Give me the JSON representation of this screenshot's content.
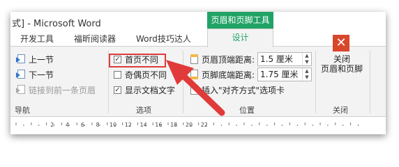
{
  "window": {
    "title": "式] - Microsoft Word"
  },
  "context_tab_header": "页眉和页脚工具",
  "tabs": [
    {
      "label": "开发工具"
    },
    {
      "label": "福昕阅读器"
    },
    {
      "label": "Word技巧达人"
    },
    {
      "label": "设计"
    }
  ],
  "navigation": {
    "prev": "上一节",
    "next": "下一节",
    "link_prev": "链接到前一条页眉",
    "group": "导航"
  },
  "options": {
    "first_page": {
      "label": "首页不同",
      "checked": true
    },
    "odd_even": {
      "label": "奇偶页不同",
      "checked": false
    },
    "show_text": {
      "label": "显示文档文字",
      "checked": true
    },
    "group": "选项"
  },
  "position": {
    "header_label": "页眉顶端距离:",
    "header_value": "1.5 厘米",
    "footer_label": "页脚底端距离:",
    "footer_value": "1.75 厘米",
    "insert_tab": "插入\"对齐方式\"选项卡",
    "group": "位置"
  },
  "close": {
    "label_line1": "关闭",
    "label_line2": "页眉和页脚",
    "group": "关闭"
  },
  "ruler": {
    "ticks": [
      "2",
      "4",
      "6",
      "8",
      "10",
      "12",
      "14",
      "16",
      "18",
      "20",
      "22"
    ]
  },
  "colors": {
    "accent": "#21a366",
    "highlight": "#e03a3a",
    "close": "#d9472b"
  }
}
